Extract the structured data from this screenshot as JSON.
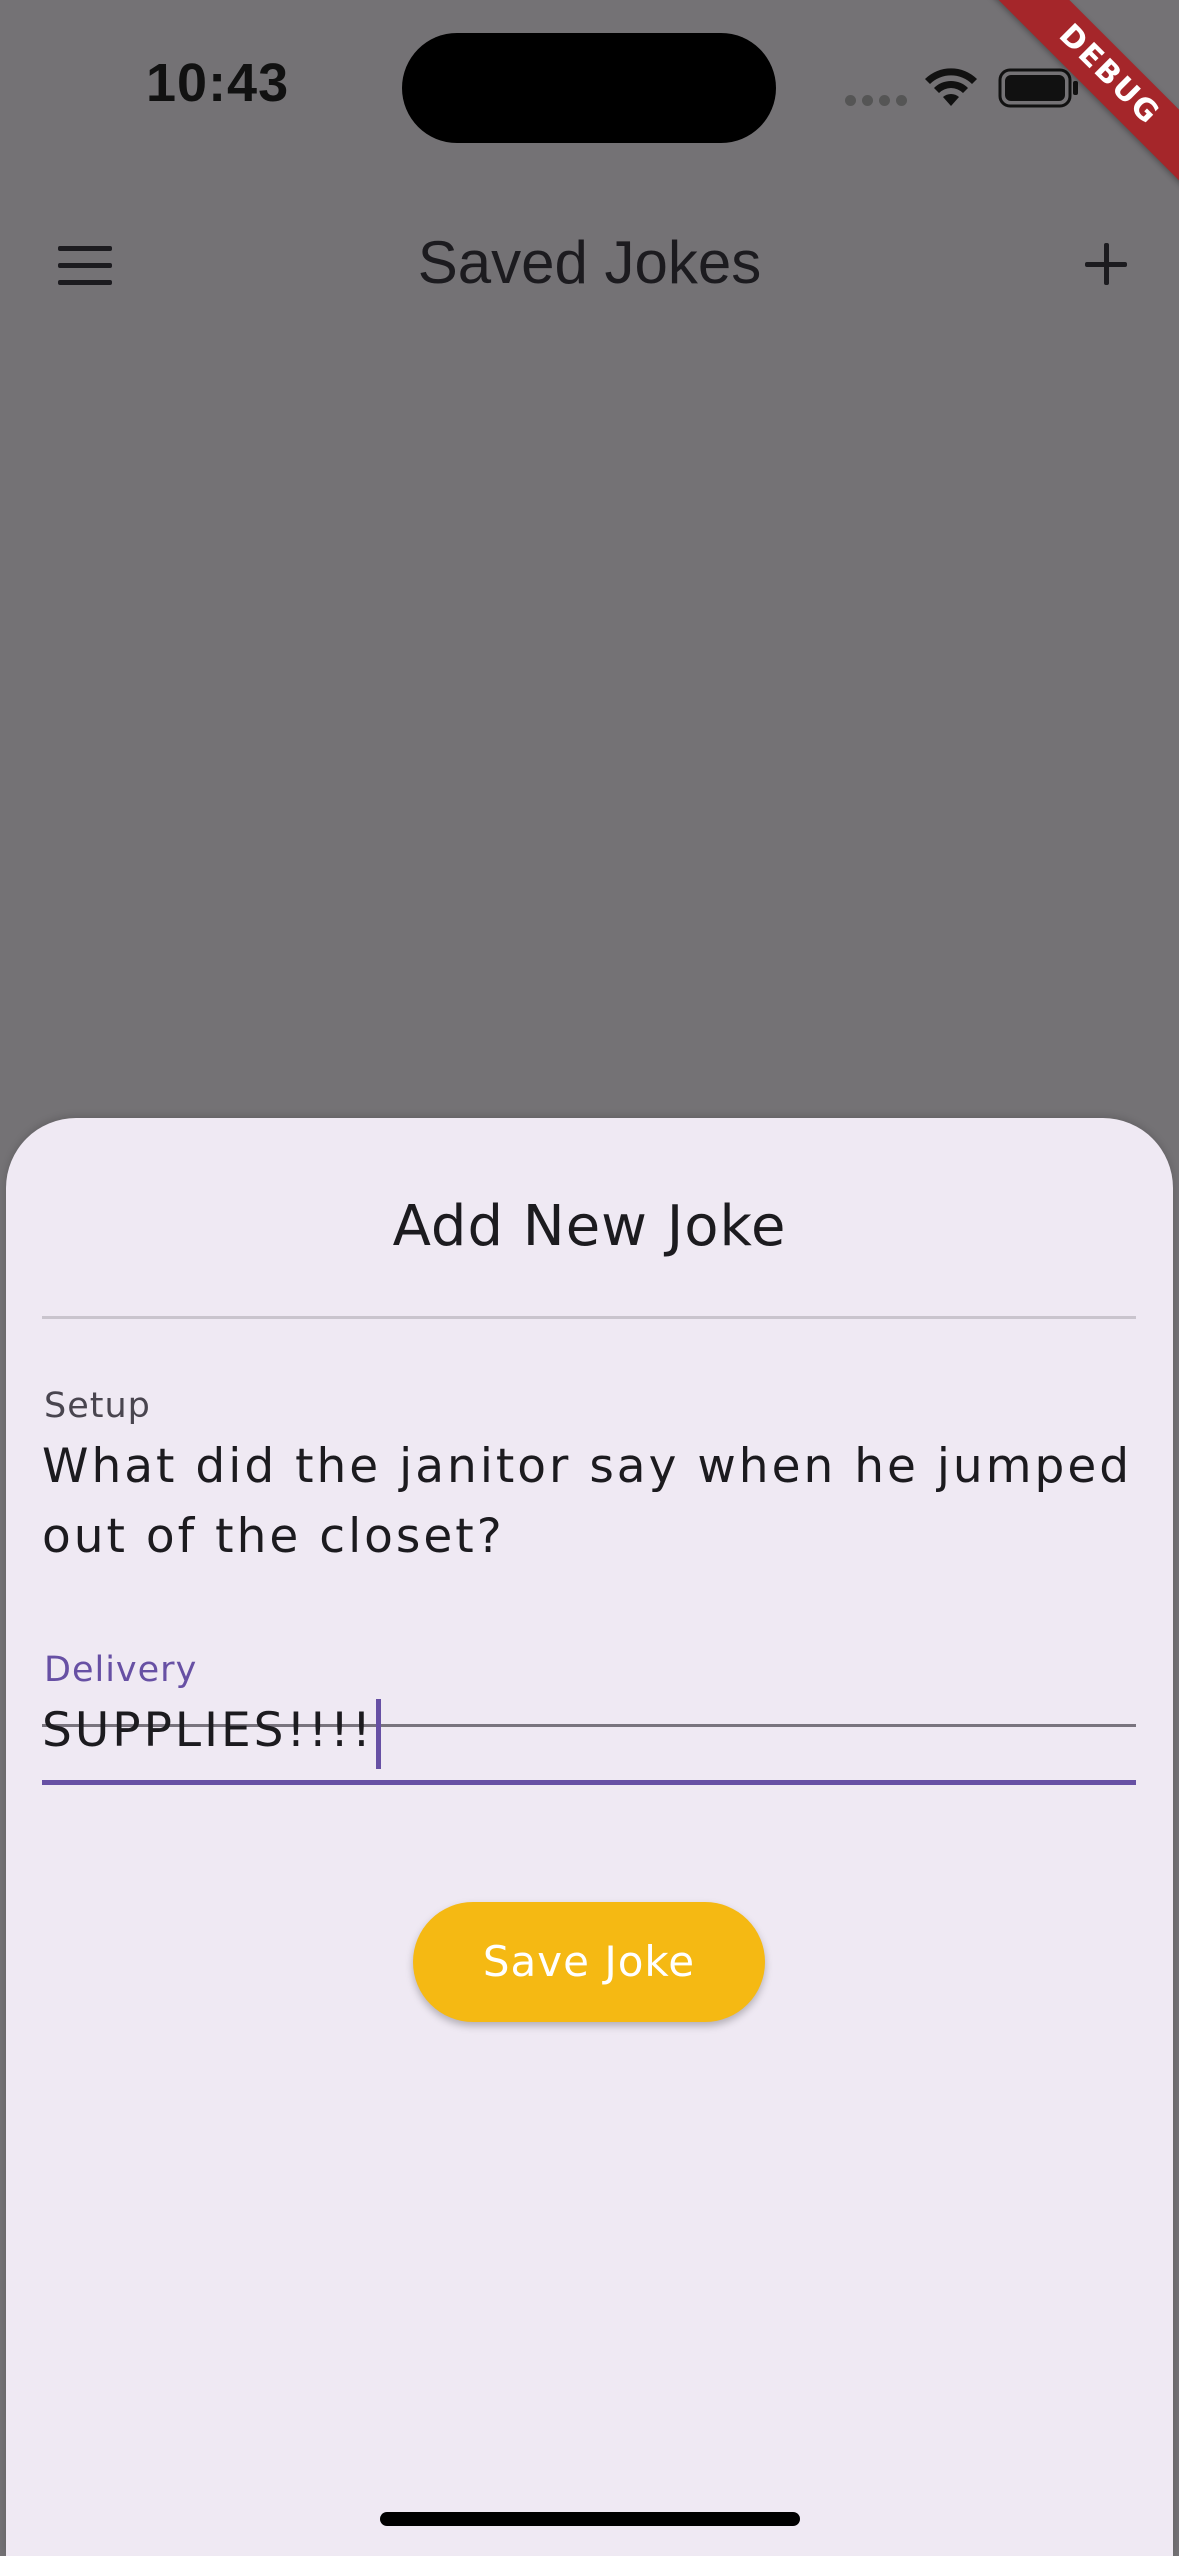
{
  "status_bar": {
    "time": "10:43"
  },
  "debug_banner": "DEBUG",
  "app_bar": {
    "title": "Saved Jokes",
    "menu_icon": "hamburger-menu-icon",
    "add_icon": "plus-icon"
  },
  "sheet": {
    "title": "Add New Joke",
    "setup": {
      "label": "Setup",
      "value": "What did the janitor say when he jumped out of the closet?"
    },
    "delivery": {
      "label": "Delivery",
      "value": "SUPPLIES!!!!"
    },
    "save_button": "Save Joke"
  },
  "colors": {
    "scrim": "#747275",
    "sheet_bg": "#efe9f3",
    "accent": "#6750a4",
    "button": "#f5b913",
    "debug": "#a5262a"
  }
}
